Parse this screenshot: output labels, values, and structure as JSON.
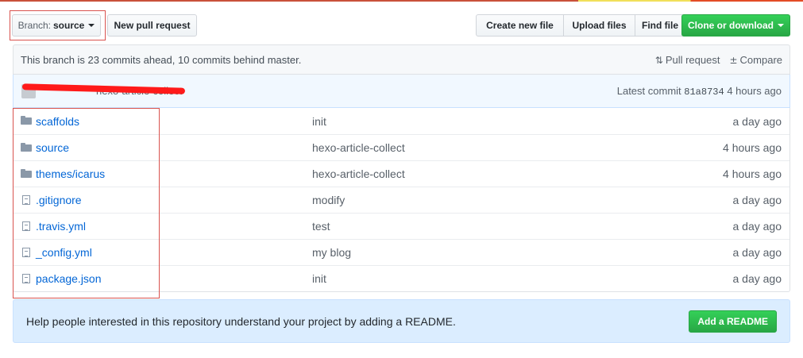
{
  "branch_button": {
    "prefix": "Branch:",
    "value": "source"
  },
  "toolbar": {
    "new_pull_request": "New pull request",
    "create_new_file": "Create new file",
    "upload_files": "Upload files",
    "find_file": "Find file",
    "clone_or_download": "Clone or download"
  },
  "branch_info": {
    "text": "This branch is 23 commits ahead, 10 commits behind master.",
    "pull_request": "Pull request",
    "compare": "Compare"
  },
  "latest_commit": {
    "message": "hexo-article-collect",
    "label": "Latest commit",
    "sha": "81a8734",
    "time": "4 hours ago"
  },
  "files": [
    {
      "type": "folder",
      "name": "scaffolds",
      "message": "init",
      "age": "a day ago"
    },
    {
      "type": "folder",
      "name": "source",
      "message": "hexo-article-collect",
      "age": "4 hours ago"
    },
    {
      "type": "folder",
      "name": "themes/icarus",
      "message": "hexo-article-collect",
      "age": "4 hours ago"
    },
    {
      "type": "file",
      "name": ".gitignore",
      "message": "modify",
      "age": "a day ago"
    },
    {
      "type": "file",
      "name": ".travis.yml",
      "message": "test",
      "age": "a day ago"
    },
    {
      "type": "file",
      "name": "_config.yml",
      "message": "my blog",
      "age": "a day ago"
    },
    {
      "type": "file",
      "name": "package.json",
      "message": "init",
      "age": "a day ago"
    }
  ],
  "readme": {
    "text": "Help people interested in this repository understand your project by adding a README.",
    "button": "Add a README"
  },
  "colors": {
    "accent_green": "#28a745",
    "link_blue": "#0366d6",
    "highlight_red": "#d9534f"
  }
}
